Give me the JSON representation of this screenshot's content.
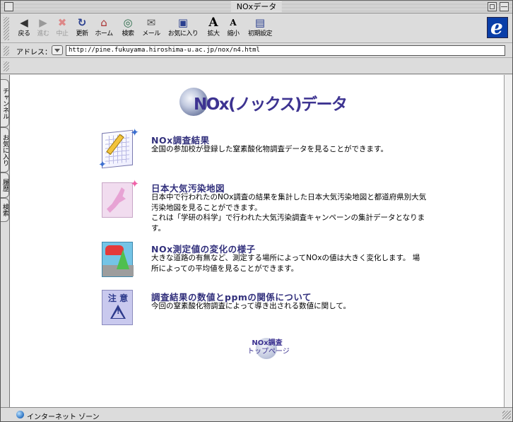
{
  "window": {
    "title": "NOxデータ"
  },
  "toolbar": {
    "buttons": [
      {
        "label": "戻る",
        "icon": "back-arrow-icon"
      },
      {
        "label": "進む",
        "icon": "forward-arrow-icon"
      },
      {
        "label": "中止",
        "icon": "stop-icon"
      },
      {
        "label": "更新",
        "icon": "refresh-icon"
      },
      {
        "label": "ホーム",
        "icon": "home-icon"
      },
      {
        "label": "検索",
        "icon": "search-icon"
      },
      {
        "label": "メール",
        "icon": "mail-icon"
      },
      {
        "label": "お気に入り",
        "icon": "favorites-icon"
      },
      {
        "label": "拡大",
        "icon": "text-larger-icon"
      },
      {
        "label": "縮小",
        "icon": "text-smaller-icon"
      },
      {
        "label": "初期設定",
        "icon": "preferences-icon"
      }
    ]
  },
  "address": {
    "label": "アドレス：",
    "url": "http://pine.fukuyama.hiroshima-u.ac.jp/nox/n4.html"
  },
  "side_tabs": [
    "チャンネル",
    "お気に入り",
    "履歴",
    "検索"
  ],
  "page": {
    "heading": "NOx(ノックス)データ",
    "items": [
      {
        "title": "NOx調査結果",
        "desc": "全国の参加校が登録した窒素酸化物調査データを見ることができます。"
      },
      {
        "title": "日本大気汚染地図",
        "desc": "日本中で行われたのNOx調査の結果を集計した日本大気汚染地図と都道府県別大気汚染地図を見ることができます。\nこれは「学研の科学」で行われた大気汚染調査キャンペーンの集計データとなります。"
      },
      {
        "title": "NOx測定値の変化の様子",
        "desc": "大きな道路の有無など、測定する場所によってNOxの値は大きく変化します。 場所によっての平均値を見ることができます。"
      },
      {
        "title": "調査結果の数値とppmの関係について",
        "desc": "今回の窒素酸化物調査によって導き出される数値に関して。"
      }
    ],
    "warn_icon_text": "注 意",
    "warn_icon_mark": "!",
    "top_link": {
      "line1": "NOx調査",
      "line2": "トップページ"
    }
  },
  "status": {
    "text": "インターネット ゾーン"
  },
  "colors": {
    "heading": "#3d3391",
    "title": "#32307c"
  }
}
